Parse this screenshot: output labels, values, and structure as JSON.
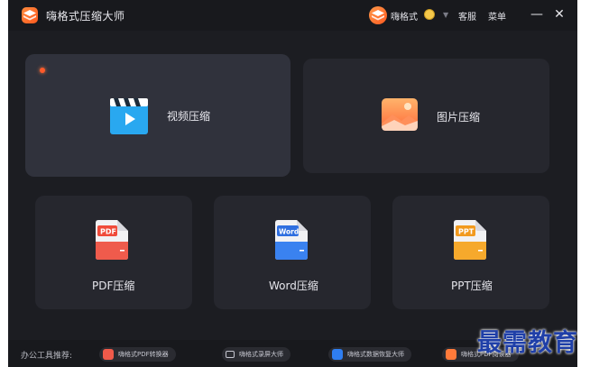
{
  "app": {
    "title": "嗨格式压缩大师"
  },
  "header": {
    "username": "嗨格式",
    "service": "客服",
    "menu": "菜单",
    "minimize": "—",
    "close": "✕"
  },
  "cards": {
    "video": {
      "label": "视频压缩"
    },
    "image": {
      "label": "图片压缩"
    },
    "pdf": {
      "label": "PDF压缩",
      "badge": "PDF"
    },
    "word": {
      "label": "Word压缩",
      "badge": "Word"
    },
    "ppt": {
      "label": "PPT压缩",
      "badge": "PPT"
    }
  },
  "footer": {
    "label": "办公工具推荐:",
    "tools": [
      {
        "label": "嗨格式PDF转换器",
        "icon": "pdf-converter-icon"
      },
      {
        "label": "嗨格式录屏大师",
        "icon": "screen-recorder-icon"
      },
      {
        "label": "嗨格式数据恢复大师",
        "icon": "data-recovery-icon"
      },
      {
        "label": "嗨格式PDF阅读器",
        "icon": "pdf-reader-icon"
      }
    ]
  },
  "watermark": "最需教育",
  "colors": {
    "accent": "#ff5a1f",
    "background": "#1c1d22",
    "card": "#26272e"
  }
}
